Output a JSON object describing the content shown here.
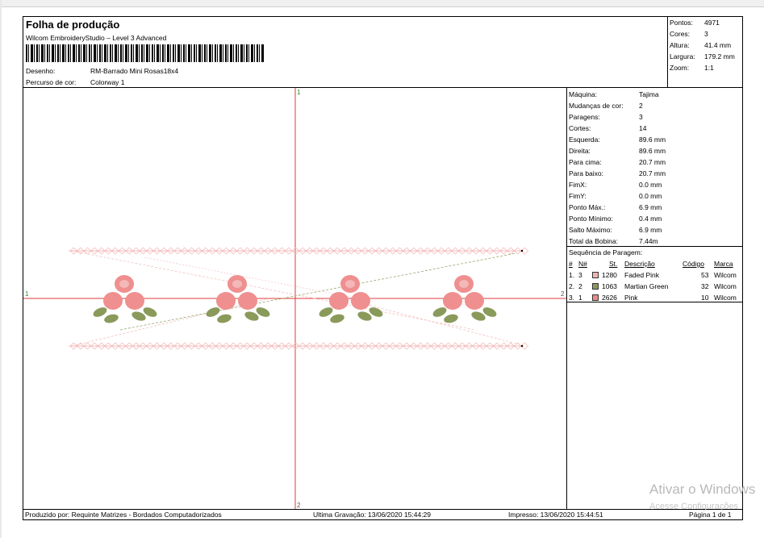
{
  "header": {
    "title": "Folha de produção",
    "software": "Wilcom EmbroideryStudio – Level 3 Advanced",
    "design_label": "Desenho:",
    "design_value": "RM-Barrado Mini Rosas18x4",
    "colorway_label": "Percurso de cor:",
    "colorway_value": "Colorway 1"
  },
  "stats": [
    {
      "label": "Pontos:",
      "value": "4971"
    },
    {
      "label": "Cores:",
      "value": "3"
    },
    {
      "label": "Altura:",
      "value": "41.4 mm"
    },
    {
      "label": "Largura:",
      "value": "179.2 mm"
    },
    {
      "label": "Zoom:",
      "value": "1:1"
    }
  ],
  "machine_info": [
    {
      "label": "Máquina:",
      "value": "Tajima"
    },
    {
      "label": "Mudanças de cor:",
      "value": "2"
    },
    {
      "label": "Paragens:",
      "value": "3"
    },
    {
      "label": "Cortes:",
      "value": "14"
    },
    {
      "label": "Esquerda:",
      "value": "89.6 mm"
    },
    {
      "label": "Direita:",
      "value": "89.6 mm"
    },
    {
      "label": "Para cima:",
      "value": "20.7 mm"
    },
    {
      "label": "Para baixo:",
      "value": "20.7 mm"
    },
    {
      "label": "FimX:",
      "value": "0.0 mm"
    },
    {
      "label": "FimY:",
      "value": "0.0 mm"
    },
    {
      "label": "Ponto Máx.:",
      "value": "6.9 mm"
    },
    {
      "label": "Ponto Mínimo:",
      "value": "0.4 mm"
    },
    {
      "label": "Salto Máximo:",
      "value": "6.9 mm"
    },
    {
      "label": "Total da Bobina:",
      "value": "7.44m"
    }
  ],
  "sequence": {
    "title": "Sequência de Paragem:",
    "headers": {
      "num": "#",
      "nnum": "N#",
      "st": "St.",
      "desc": "Descrição",
      "code": "Código",
      "brand": "Marca"
    },
    "rows": [
      {
        "num": "1.",
        "nnum": "3",
        "st": "1280",
        "desc": "Faded Pink",
        "code": "53",
        "brand": "Wilcom",
        "color": "#f2b3b3"
      },
      {
        "num": "2.",
        "nnum": "2",
        "st": "1063",
        "desc": "Martian Green",
        "code": "32",
        "brand": "Wilcom",
        "color": "#8a9a5b"
      },
      {
        "num": "3.",
        "nnum": "1",
        "st": "2626",
        "desc": "Pink",
        "code": "10",
        "brand": "Wilcom",
        "color": "#f08a8a"
      }
    ]
  },
  "canvas": {
    "marker_top": "1",
    "marker_bottom": "2",
    "marker_left": "1",
    "marker_right": "2"
  },
  "footer": {
    "produced_by": "Produzido por: Requinte Matrizes - Bordados Computadorizados",
    "last_saved": "Ultima Gravação: 13/06/2020 15:44:29",
    "printed": "Impresso: 13/06/2020 15:44:51",
    "page": "Página 1 de 1"
  },
  "watermark": {
    "line1": "Ativar o Windows",
    "line2": "Acesse Configurações"
  },
  "colors": {
    "axis": "#e23b3b",
    "pink_light": "#f4b8b8",
    "pink": "#ef8f8f",
    "green": "#8a9a5b"
  }
}
